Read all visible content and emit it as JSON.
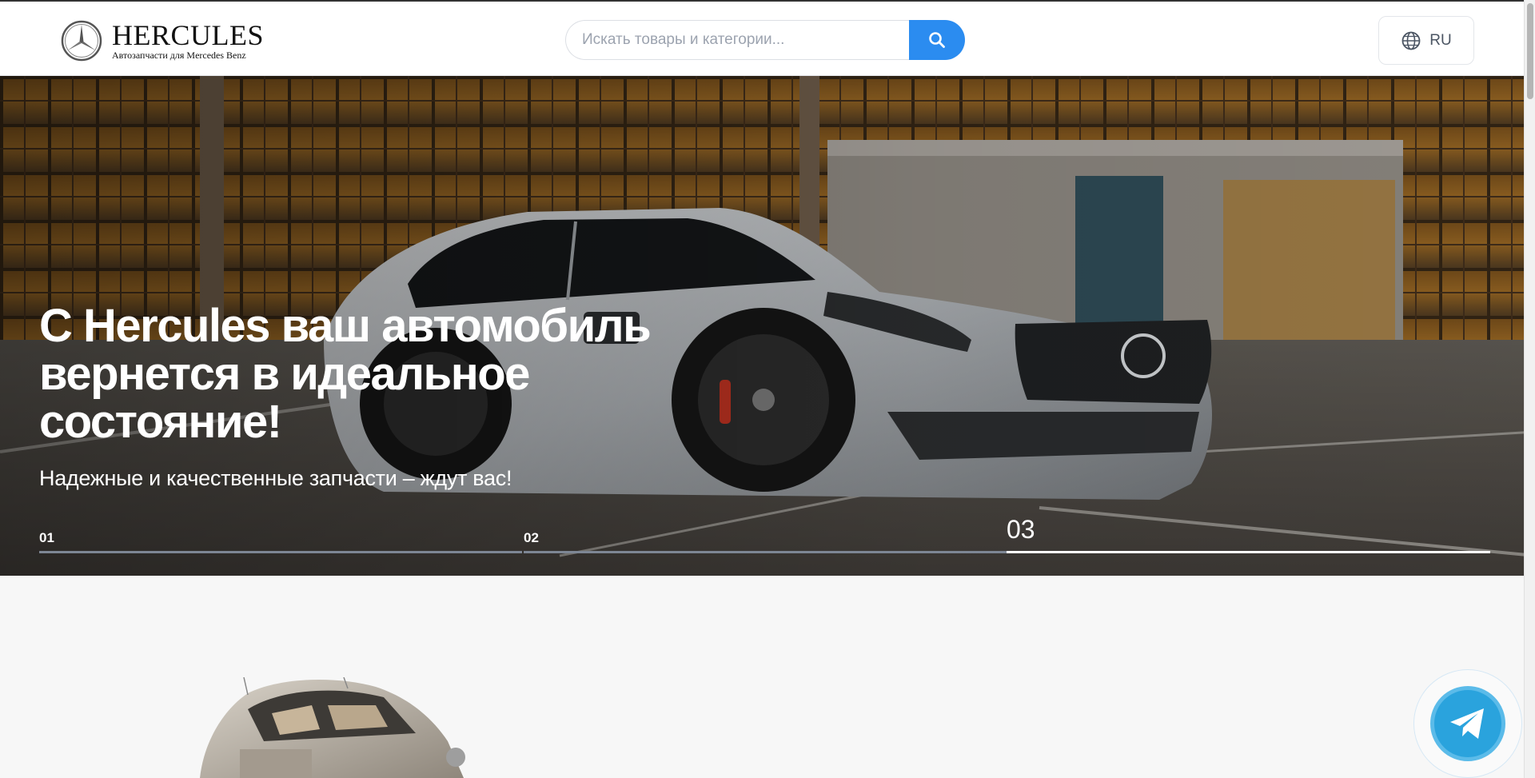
{
  "header": {
    "logo": {
      "name": "HERCULES",
      "tagline": "Автозапчасти для Mercedes Benz",
      "emblem_icon": "mercedes-star-icon"
    },
    "search": {
      "placeholder": "Искать товары и категории...",
      "value": "",
      "button_icon": "search-icon"
    },
    "language": {
      "label": "RU",
      "icon": "globe-icon"
    }
  },
  "hero": {
    "title": "С Hercules ваш автомобиль вернется в идеальное состояние!",
    "subtitle": "Надежные и качественные запчасти – ждут вас!",
    "slides": [
      {
        "label": "01",
        "active": false
      },
      {
        "label": "02",
        "active": false
      },
      {
        "label": "03",
        "active": true
      }
    ]
  },
  "floating": {
    "telegram_icon": "telegram-icon"
  },
  "colors": {
    "accent": "#2b8cf0",
    "telegram": "#2aa3dd",
    "slider_inactive": "#7d8694",
    "slider_active": "#ffffff"
  }
}
